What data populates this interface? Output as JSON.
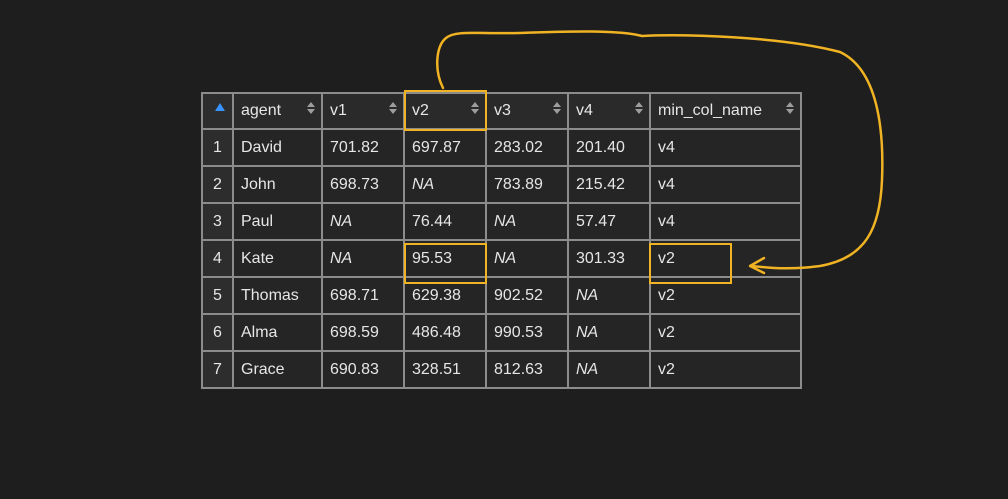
{
  "table": {
    "columns": [
      "agent",
      "v1",
      "v2",
      "v3",
      "v4",
      "min_col_name"
    ],
    "rows": [
      [
        "1",
        "David",
        "701.82",
        "697.87",
        "283.02",
        "201.40",
        "v4"
      ],
      [
        "2",
        "John",
        "698.73",
        "NA",
        "783.89",
        "215.42",
        "v4"
      ],
      [
        "3",
        "Paul",
        "NA",
        "76.44",
        "NA",
        "57.47",
        "v4"
      ],
      [
        "4",
        "Kate",
        "NA",
        "95.53",
        "NA",
        "301.33",
        "v2"
      ],
      [
        "5",
        "Thomas",
        "698.71",
        "629.38",
        "902.52",
        "NA",
        "v2"
      ],
      [
        "6",
        "Alma",
        "698.59",
        "486.48",
        "990.53",
        "NA",
        "v2"
      ],
      [
        "7",
        "Grace",
        "690.83",
        "328.51",
        "812.63",
        "NA",
        "v2"
      ]
    ],
    "sort_icon": "sort-updown-icon",
    "index_sort_icon": "sort-ascending-icon"
  },
  "annotation": {
    "color": "#f0b323",
    "highlighted_header": "v2",
    "highlighted_row": "4",
    "highlighted_columns": [
      "v2",
      "min_col_name"
    ],
    "arrow_icon": "curved-arrow-icon"
  },
  "colors": {
    "background": "#1e1e1e",
    "cell": "#252526",
    "border": "#8c8c8c",
    "text": "#e6e6e6",
    "na_text": "#a8a8a8",
    "sort_accent": "#3794ff"
  }
}
